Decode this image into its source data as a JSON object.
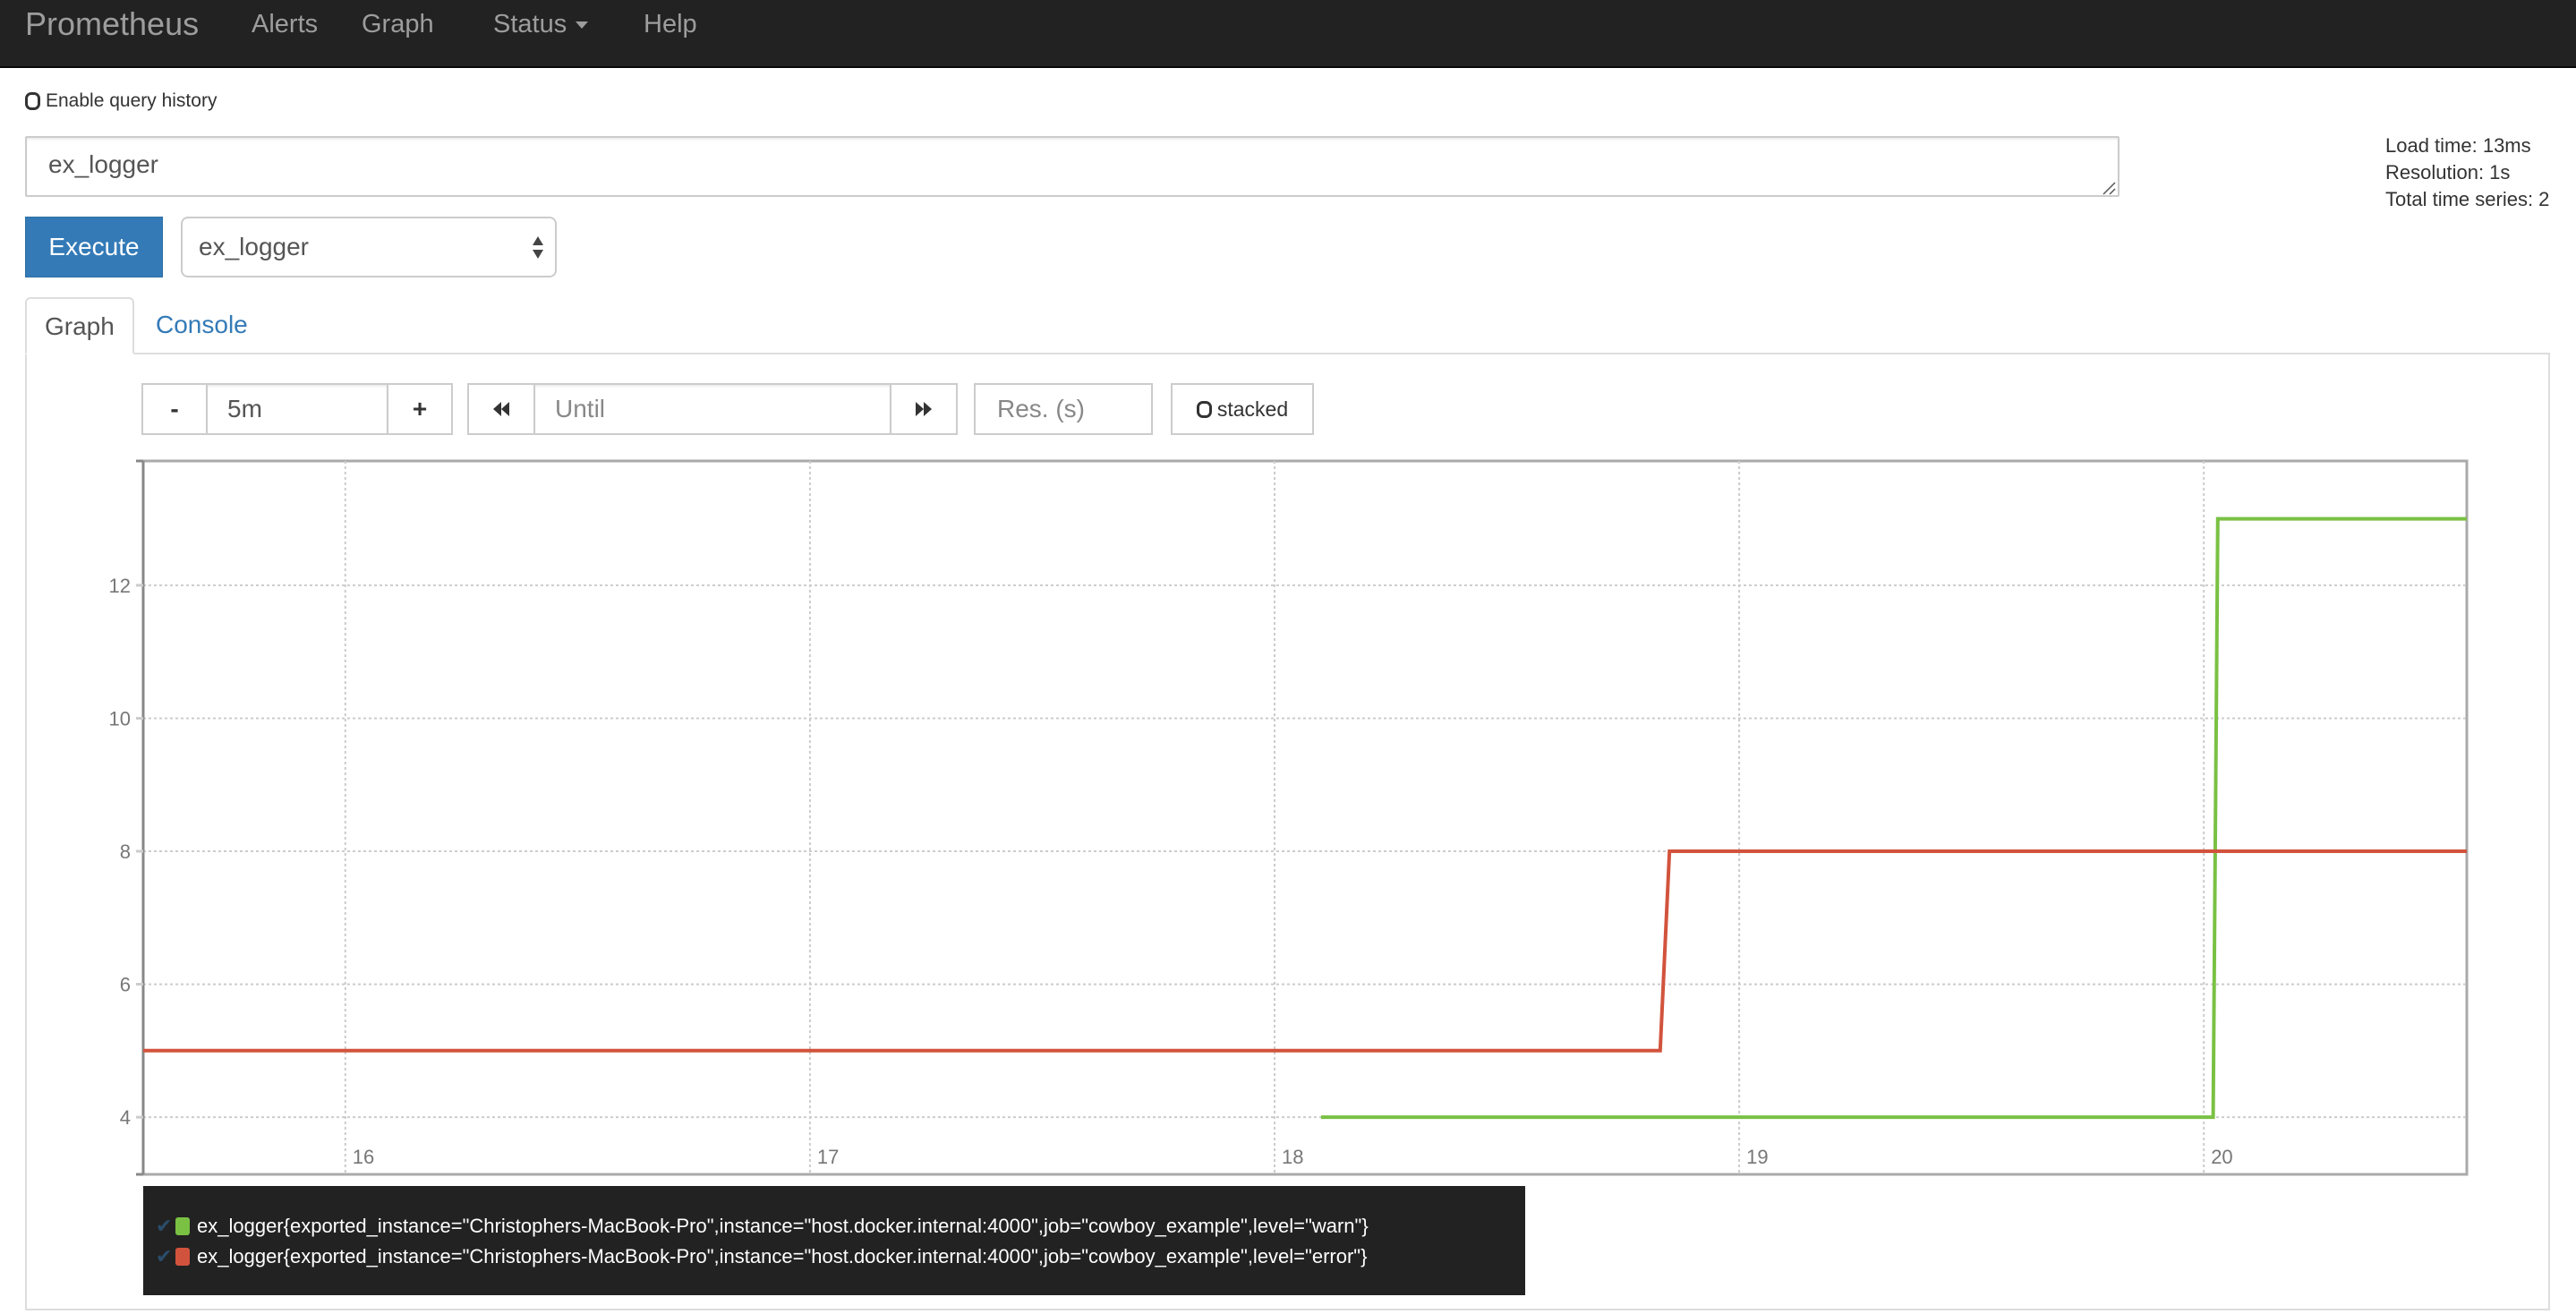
{
  "navbar": {
    "brand": "Prometheus",
    "items": [
      {
        "label": "Alerts"
      },
      {
        "label": "Graph"
      },
      {
        "label": "Status",
        "has_dropdown": true
      },
      {
        "label": "Help"
      }
    ]
  },
  "query_history": {
    "label": "Enable query history",
    "checked": false
  },
  "expression": {
    "value": "ex_logger"
  },
  "stats": {
    "load_time": "Load time: 13ms",
    "resolution": "Resolution: 1s",
    "total_series": "Total time series: 2"
  },
  "execute": {
    "label": "Execute"
  },
  "metric_select": {
    "selected": "ex_logger"
  },
  "tabs": [
    {
      "label": "Graph",
      "active": true
    },
    {
      "label": "Console",
      "active": false
    }
  ],
  "graph_controls": {
    "range_decrease": "-",
    "range_value": "5m",
    "range_increase": "+",
    "until_placeholder": "Until",
    "resolution_placeholder": "Res. (s)",
    "stacked_label": "stacked",
    "stacked_checked": false
  },
  "colors": {
    "navbar_bg": "#222222",
    "accent": "#337ab7",
    "series_warn": "#7ac143",
    "series_error": "#d2533d"
  },
  "chart_data": {
    "type": "line",
    "title": "",
    "xlabel": "",
    "ylabel": "",
    "x_ticks": [
      16,
      17,
      18,
      19,
      20
    ],
    "x_tick_labels": [
      "16",
      "17",
      "18",
      "19",
      "20"
    ],
    "xlim": [
      15.565,
      20.566
    ],
    "y_ticks": [
      4,
      6,
      8,
      10,
      12
    ],
    "y_tick_labels": [
      "4",
      "6",
      "8",
      "10",
      "12"
    ],
    "ylim": [
      3.14,
      13.87
    ],
    "grid": true,
    "legend_position": "bottom-left",
    "series": [
      {
        "name": "ex_logger{exported_instance=\"Christophers-MacBook-Pro\",instance=\"host.docker.internal:4000\",job=\"cowboy_example\",level=\"warn\"}",
        "color": "#7ac143",
        "x": [
          18.1,
          20.02,
          20.03,
          20.566
        ],
        "y": [
          4,
          4,
          13,
          13
        ]
      },
      {
        "name": "ex_logger{exported_instance=\"Christophers-MacBook-Pro\",instance=\"host.docker.internal:4000\",job=\"cowboy_example\",level=\"error\"}",
        "color": "#d2533d",
        "x": [
          15.565,
          18.83,
          18.85,
          20.566
        ],
        "y": [
          5,
          5,
          8,
          8
        ]
      }
    ]
  }
}
